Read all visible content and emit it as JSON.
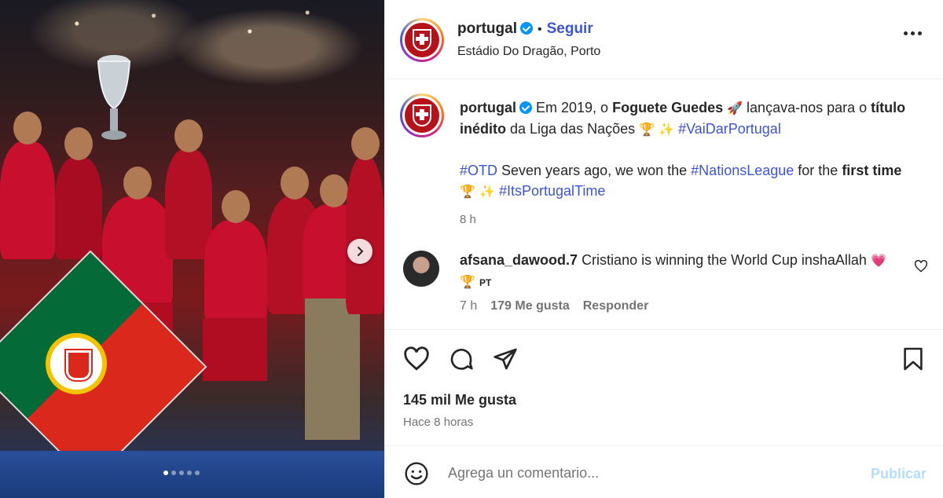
{
  "post": {
    "username": "portugal",
    "follow_label": "Seguir",
    "location": "Estádio Do Dragão, Porto",
    "caption": {
      "username": "portugal",
      "p1_a": "Em 2019, o ",
      "p1_b": "Foguete Guedes",
      "p1_c": "🚀",
      "p1_d": " lançava-nos para o ",
      "p1_e": "título inédito",
      "p1_f": " da Liga das Nações ",
      "p1_g": "🏆 ✨",
      "p1_tag": "#VaiDarPortugal",
      "p2_tag1": "#OTD",
      "p2_a": " Seven years ago, we won the ",
      "p2_tag2": "#NationsLeague",
      "p2_b": " for the ",
      "p2_c": "first time",
      "p2_d": "🏆 ✨",
      "p2_tag3": "#ItsPortugalTime",
      "time": "8 h"
    },
    "comment": {
      "username": "afsana_dawood.7",
      "text": "Cristiano is winning the World Cup insha​Allah",
      "emojis": "💗 🏆",
      "flag": "PT",
      "time": "7 h",
      "likes": "179 Me gusta",
      "reply": "Responder"
    },
    "likes_count": "145 mil Me gusta",
    "posted_ago": "Hace 8 horas",
    "comment_placeholder": "Agrega un comentario...",
    "publish_label": "Publicar",
    "carousel": {
      "total": 5,
      "active": 1
    }
  }
}
